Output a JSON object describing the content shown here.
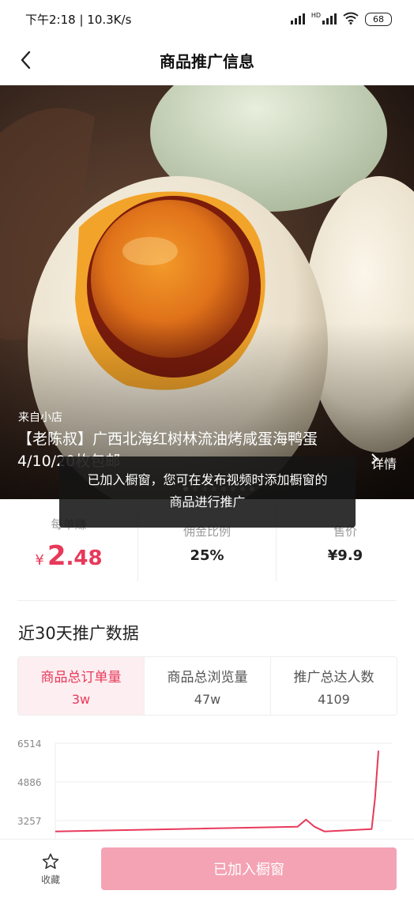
{
  "status_bar": {
    "time_speed": "下午2:18 | 10.3K/s",
    "hd_label": "HD",
    "battery": "68"
  },
  "nav": {
    "title": "商品推广信息"
  },
  "product": {
    "shop_label": "来自小店",
    "title": "【老陈叔】广西北海红树林流油烤咸蛋海鸭蛋4/10/20枚包邮",
    "details_link": "详情"
  },
  "stats": [
    {
      "label": "每单赚",
      "currency": "¥",
      "value_int": "2",
      "value_dec": ".48"
    },
    {
      "label": "佣金比例",
      "value": "25%"
    },
    {
      "label": "售价",
      "value": "¥9.9"
    }
  ],
  "promo": {
    "section_title": "近30天推广数据",
    "tabs": [
      {
        "label": "商品总订单量",
        "value": "3w"
      },
      {
        "label": "商品总浏览量",
        "value": "47w"
      },
      {
        "label": "推广总达人数",
        "value": "4109"
      }
    ]
  },
  "chart_data": {
    "type": "line",
    "yticks": [
      "6514",
      "4886",
      "3257"
    ],
    "ylim": [
      3257,
      6514
    ],
    "line_color": "#e8395a",
    "series": [
      {
        "x": [
          0.0,
          0.72,
          0.745,
          0.77,
          0.8,
          0.94,
          0.95,
          0.96
        ],
        "y": [
          2800,
          3000,
          3300,
          3000,
          2800,
          2900,
          4200,
          6200
        ]
      }
    ]
  },
  "toast": {
    "message": "已加入橱窗，您可在发布视频时添加橱窗的商品进行推广"
  },
  "bottom": {
    "fav_label": "收藏",
    "added_label": "已加入橱窗"
  },
  "colors": {
    "accent": "#e8395a",
    "button_disabled": "#f4a3b4"
  }
}
